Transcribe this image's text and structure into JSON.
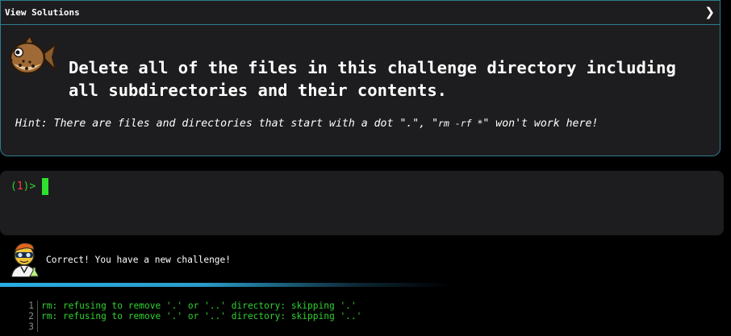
{
  "header": {
    "view_solutions_label": "View Solutions",
    "chevron_icon": "chevron-right-icon"
  },
  "challenge": {
    "title": "Delete all of the files in this challenge directory including all subdirectories and their contents.",
    "hint_prefix": "Hint: There are files and directories that start with a dot \".\", \"",
    "hint_code": "rm -rf *",
    "hint_suffix": "\" won't work here!",
    "mascot_icon": "pufferfish-icon"
  },
  "terminal": {
    "prompt_open": "(",
    "prompt_number": "1",
    "prompt_close": ")>",
    "input_value": ""
  },
  "feedback": {
    "message": "Correct! You have a new challenge!",
    "avatar_icon": "scientist-avatar-icon"
  },
  "output": {
    "lines": [
      {
        "number": "1",
        "text": "rm: refusing to remove '.' or '..' directory: skipping '.'"
      },
      {
        "number": "2",
        "text": "rm: refusing to remove '.' or '..' directory: skipping '..'"
      },
      {
        "number": "3",
        "text": ""
      }
    ]
  },
  "colors": {
    "panel_bg": "#1d1d1f",
    "border": "#2e7d8c",
    "prompt_green": "#2fd22f",
    "prompt_red": "#ff3b3b",
    "divider_blue": "#27aee3"
  }
}
